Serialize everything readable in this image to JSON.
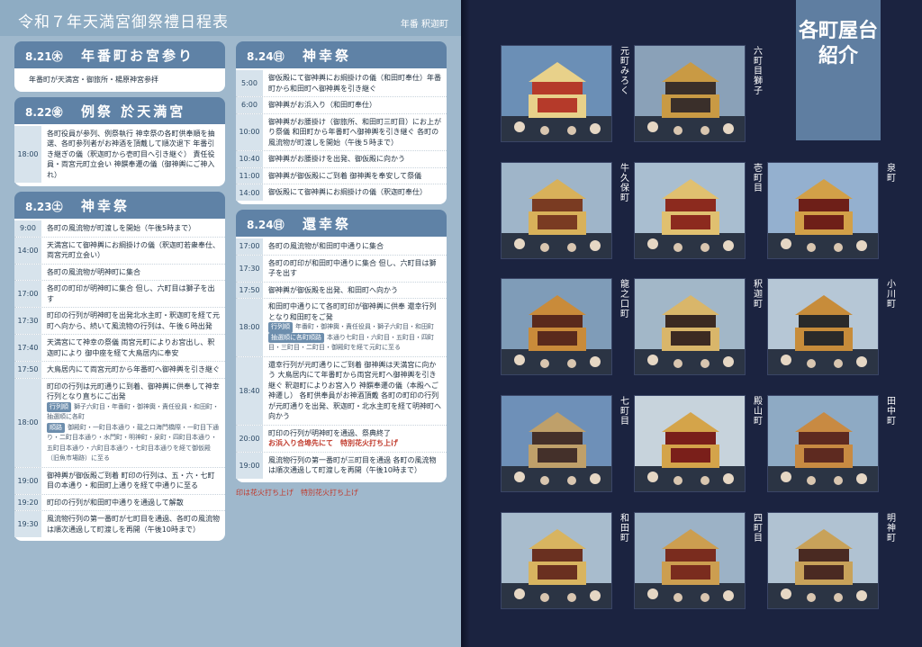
{
  "left_page": {
    "title": "令和７年天満宮御祭禮日程表",
    "subtitle": "年番 釈迦町",
    "sections": [
      {
        "date": "8.21㊍",
        "name": "年番町お宮参り",
        "note": "年番町が天満宮・御旅所・楊原神宮参拝"
      },
      {
        "date": "8.22㊎",
        "name": "例祭 於天満宮",
        "rows": [
          {
            "time": "18:00",
            "text": "各町役員が参列、例祭執行 神幸祭の各町供奉順を抽選、各町参列者がお神酒を頂戴して順次退下 年番引き継ぎの儀（釈迦町から壱町目へ引き継ぐ） 責任役員・両宮元町立会い 神饌奉遷の儀（御神輿にご神入れ）"
          }
        ]
      },
      {
        "date": "8.23㊏",
        "name": "神幸祭",
        "rows": [
          {
            "time": "9:00",
            "text": "各町の風流物が町渡しを開始（午後5時まで）"
          },
          {
            "time": "14:00",
            "text": "天満宮にて御神輿にお綱掛けの儀（釈迦町若衆奉仕、両宮元町立会い）"
          },
          {
            "time": "",
            "text": "各町の風流物が明神町に集合"
          },
          {
            "time": "17:00",
            "text": "各町の町印が明神町に集合 但し、六町目は獅子を出す"
          },
          {
            "time": "17:30",
            "text": "町印の行列が明神町を出発北水主町・釈迦町を経て元町へ向から、続いて風流物の行列は、午後６時出発"
          },
          {
            "time": "17:40",
            "text": "天満宮にて神幸の祭儀 両宮元町によりお宮出し、釈迦町により 御中座を経て大鳥居内に奉安"
          },
          {
            "time": "17:50",
            "text": "大鳥居内にて両宮元町から年番町へ御神輿を引き継ぐ"
          },
          {
            "time": "18:00",
            "text": "町印の行列は元町通りに到着、御神輿に供奉して神幸行列となり直ちにご出発",
            "tag1": "行列順",
            "detail1": "獅子六町目・年番町・御神輿・責任役員・和田町・抽選順に各町",
            "tag2": "順路",
            "detail2": "御殿町・一町目本通り・龍之口海門橋際・一町目下通り・二町目本通り・水門町・明神町・泉町・四町目本通り・五町目本通り・六町目本通り・七町目本通りを経て御仮殿（旧魚市場跡）に至る"
          },
          {
            "time": "19:00",
            "text": "御神輿が御仮殿ご到着 町印の行列は、五・六・七町目の本通り・和田町上通りを経て中通りに至る"
          },
          {
            "time": "19:20",
            "text": "町印の行列が和田町中通りを通過して解散"
          },
          {
            "time": "19:30",
            "text": "風流物行列の第一番町が七町目を通過、各町の風流物は順次通過して町渡しを再開（午後10時まで）"
          }
        ]
      }
    ],
    "sections_b": [
      {
        "date": "8.24㊐",
        "name": "神幸祭",
        "rows": [
          {
            "time": "5:00",
            "text": "御仮殿にて御神輿にお綱掛けの儀（和田町奉仕）年番町から和田町へ御神輿を引き継ぐ"
          },
          {
            "time": "6:00",
            "text": "御神輿がお浜入り（和田町奉仕）"
          },
          {
            "time": "10:00",
            "text": "御神輿がお腰掛け（御旅所、和田町三町目）にお上がり祭儀 和田町から年番町へ御神輿を引き継ぐ 各町の風流物が町渡しを開始（午後５時まで）"
          },
          {
            "time": "10:40",
            "text": "御神輿がお腰掛けを出発、御仮殿に向かう"
          },
          {
            "time": "11:00",
            "text": "御神輿が御仮殿にご到着 御神輿を奉安して祭儀"
          },
          {
            "time": "14:00",
            "text": "御仮殿にて御神輿にお綱掛けの儀（釈迦町奉仕）"
          }
        ]
      },
      {
        "date": "8.24㊐",
        "name": "還幸祭",
        "rows": [
          {
            "time": "17:00",
            "text": "各町の風流物が和田町中通りに集合"
          },
          {
            "time": "17:30",
            "text": "各町の町印が和田町中通りに集合 但し、六町目は獅子を出す"
          },
          {
            "time": "17:50",
            "text": "御神輿が御仮殿を出発、和田町へ向かう"
          },
          {
            "time": "18:00",
            "text": "和田町中通りにて各町町印が御神輿に供奉 還幸行列となり和田町をご発",
            "tag1": "行列順",
            "detail1": "年番町・御神輿・責任役員・獅子六町目・和田町",
            "tag2": "抽選順に各町順路",
            "detail2": "本通り七町目・六町目・五町目・四町目・三町目・二町目・御殿町を経て元町に至る"
          },
          {
            "time": "18:40",
            "text": "還幸行列が元町通りにご到着 御神輿は天満宮に向かう 大鳥居内にて年番町から両宮元町へ御神輿を引き継ぐ 釈迦町によりお宮入り 神饌奉遷の儀（本殿へご神遷し） 各町供奉員がお神酒頂戴 各町の町印の行列が元町通りを出発、釈迦町・北水主町を経て明神町へ向かう"
          },
          {
            "time": "20:00",
            "text": "町印の行列が明神町を通過、祭典終了",
            "highlight": "お浜入り合埠先にて　特別花火打ち上げ"
          },
          {
            "time": "19:00",
            "text": "風流物行列の第一番町が三町目を通過 各町の風流物は順次通過して町渡しを再開（午後10時まで）"
          }
        ]
      }
    ],
    "legend": "印は花火打ち上げ　特別花火打ち上げ"
  },
  "right_page": {
    "title": "各町屋台紹介",
    "towns": [
      "元町みろく",
      "六町目獅子",
      "牛久保町",
      "壱町目",
      "泉町",
      "龍之口町",
      "釈迦町",
      "小川町",
      "七町目",
      "殿山町",
      "田中町",
      "和田町",
      "四町目",
      "明神町"
    ]
  }
}
